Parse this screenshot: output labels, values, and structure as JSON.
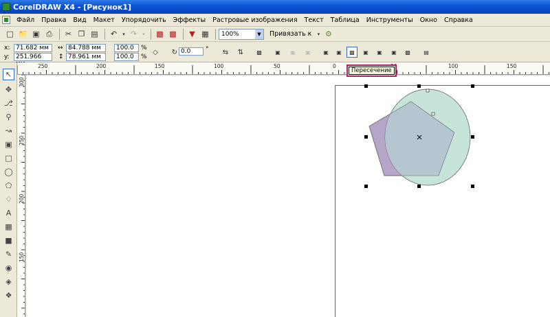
{
  "window": {
    "title": "CorelDRAW X4 - [Рисунок1]"
  },
  "menu": {
    "items": [
      "Файл",
      "Правка",
      "Вид",
      "Макет",
      "Упорядочить",
      "Эффекты",
      "Растровые изображения",
      "Текст",
      "Таблица",
      "Инструменты",
      "Окно",
      "Справка"
    ]
  },
  "toolbar": {
    "zoom": "100%",
    "snap_label": "Привязать к"
  },
  "properties": {
    "x_label": "x:",
    "y_label": "y:",
    "x_value": "71.682 мм",
    "y_value": "251.966 мм",
    "width_value": "84.788 мм",
    "height_value": "78.961 мм",
    "scale_x": "100.0",
    "scale_y": "100.0",
    "percent": "%",
    "angle": "0.0",
    "degree": "°"
  },
  "ruler": {
    "h_labels": [
      "250",
      "200",
      "150",
      "100",
      "50",
      "0",
      "50",
      "100",
      "150"
    ],
    "v_labels": [
      "300",
      "250",
      "200",
      "150"
    ]
  },
  "tooltip": {
    "text": "Пересечение"
  },
  "colors": {
    "pentagon_fill": "#b4a5c9",
    "circle_fill": "#c6e4d7",
    "intersection_fill": "#b5c6d1",
    "tooltip_highlight": "#c0185f",
    "title_bar": "#0a53d6"
  }
}
